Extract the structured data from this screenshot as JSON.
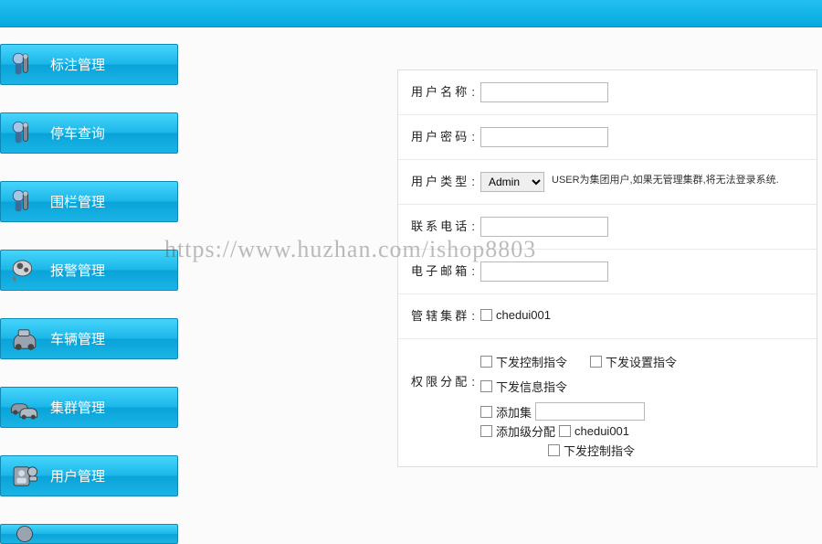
{
  "sidebar": {
    "items": [
      {
        "label": "标注管理",
        "iconName": "marker-icon"
      },
      {
        "label": "停车查询",
        "iconName": "parking-icon"
      },
      {
        "label": "围栏管理",
        "iconName": "fence-icon"
      },
      {
        "label": "报警管理",
        "iconName": "alarm-icon"
      },
      {
        "label": "车辆管理",
        "iconName": "vehicle-icon"
      },
      {
        "label": "集群管理",
        "iconName": "cluster-icon"
      },
      {
        "label": "用户管理",
        "iconName": "user-mgmt-icon"
      }
    ]
  },
  "form": {
    "username_label": "用户名称",
    "username_value": "",
    "password_label": "用户密码",
    "password_value": "",
    "usertype_label": "用户类型",
    "usertype_value": "Admin",
    "usertype_hint": "USER为集团用户,如果无管理集群,将无法登录系统.",
    "phone_label": "联系电话",
    "phone_value": "",
    "email_label": "电子邮箱",
    "email_value": "",
    "managed_cluster_label": "管辖集群",
    "managed_cluster_option": "chedui001",
    "perm_label": "权限分配",
    "perm_options": [
      "下发控制指令",
      "下发设置指令",
      "下发信息指令"
    ],
    "add_cluster_label": "添加集",
    "add_group_label": "添加级分配",
    "add_group_option": "chedui001",
    "add_ctrl_label": "下发控制指令"
  },
  "watermark": "https://www.huzhan.com/ishop8803"
}
